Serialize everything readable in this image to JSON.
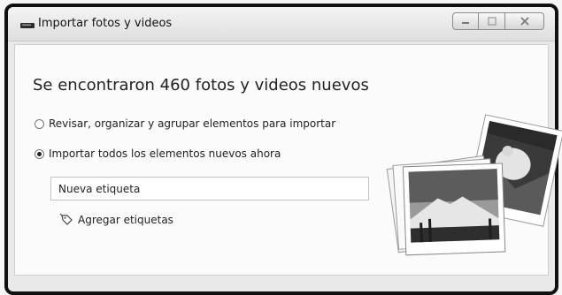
{
  "window": {
    "title": "Importar fotos y videos",
    "controls": {
      "minimize": "minimize-icon",
      "maximize": "maximize-icon",
      "close": "close-icon"
    }
  },
  "main": {
    "headline": "Se encontraron 460 fotos y videos nuevos",
    "options": [
      {
        "label": "Revisar, organizar y agrupar elementos para importar",
        "selected": false
      },
      {
        "label": "Importar todos los elementos nuevos ahora",
        "selected": true
      }
    ],
    "tag_input": {
      "value": "Nueva etiqueta",
      "placeholder": ""
    },
    "add_tags_label": "Agregar etiquetas"
  },
  "icons": {
    "title": "drive-icon",
    "add_tags": "tag-icon",
    "illustration": "photos-illustration-icon"
  },
  "colors": {
    "frame": "#111111",
    "background": "#fbfbfb",
    "text": "#222222"
  }
}
